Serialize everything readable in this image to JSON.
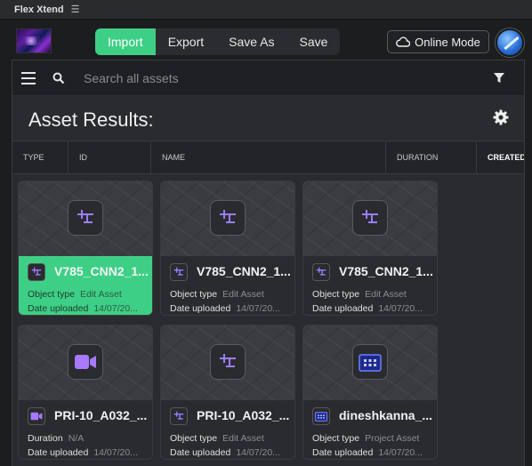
{
  "app": {
    "title": "Flex Xtend",
    "menu_icon": "hamburger-icon"
  },
  "toolbar": {
    "tabs": [
      "Import",
      "Export",
      "Save As",
      "Save"
    ],
    "active_tab": "Import",
    "online_mode_label": "Online Mode"
  },
  "search": {
    "placeholder": "Search all assets"
  },
  "results": {
    "title": "Asset Results:"
  },
  "columns": [
    "TYPE",
    "ID",
    "NAME",
    "DURATION",
    "CREATED"
  ],
  "colors": {
    "accent": "#3ecf86",
    "icon_purple": "#9b7dff",
    "background": "#1c1d1f"
  },
  "cards": [
    {
      "name": "V785_CNN2_1...",
      "icon": "edit-asset-icon",
      "row1_key": "Object type",
      "row1_val": "Edit Asset",
      "row2_key": "Date uploaded",
      "row2_val": "14/07/20...",
      "selected": true
    },
    {
      "name": "V785_CNN2_1...",
      "icon": "edit-asset-icon",
      "row1_key": "Object type",
      "row1_val": "Edit Asset",
      "row2_key": "Date uploaded",
      "row2_val": "14/07/20...",
      "selected": false
    },
    {
      "name": "V785_CNN2_1...",
      "icon": "edit-asset-icon",
      "row1_key": "Object type",
      "row1_val": "Edit Asset",
      "row2_key": "Date uploaded",
      "row2_val": "14/07/20...",
      "selected": false
    },
    {
      "name": "PRI-10_A032_...",
      "icon": "video-icon",
      "row1_key": "Duration",
      "row1_val": "N/A",
      "row2_key": "Date uploaded",
      "row2_val": "14/07/20...",
      "selected": false
    },
    {
      "name": "PRI-10_A032_...",
      "icon": "edit-asset-icon",
      "row1_key": "Object type",
      "row1_val": "Edit Asset",
      "row2_key": "Date uploaded",
      "row2_val": "14/07/20...",
      "selected": false
    },
    {
      "name": "dineshkanna_...",
      "icon": "project-icon",
      "row1_key": "Object type",
      "row1_val": "Project Asset",
      "row2_key": "Date uploaded",
      "row2_val": "14/07/20...",
      "selected": false
    }
  ]
}
